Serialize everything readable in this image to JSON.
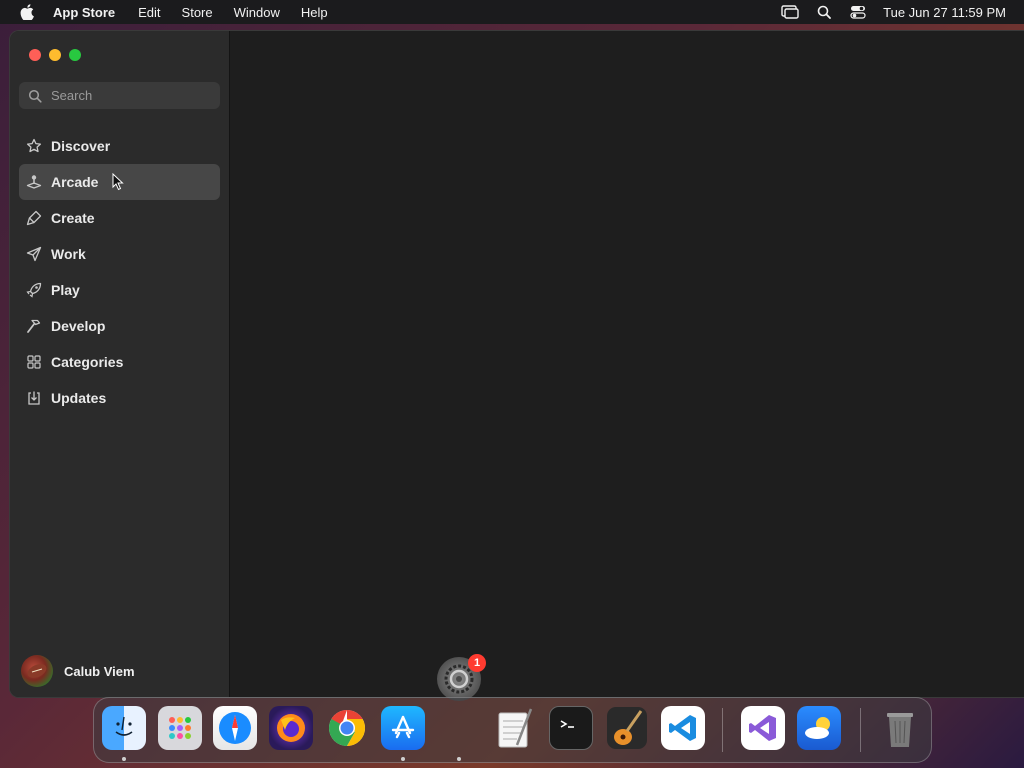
{
  "menubar": {
    "app_name": "App Store",
    "items": [
      "Edit",
      "Store",
      "Window",
      "Help"
    ],
    "clock": "Tue Jun 27  11:59 PM"
  },
  "sidebar": {
    "search_placeholder": "Search",
    "items": [
      {
        "label": "Discover",
        "icon": "star-icon"
      },
      {
        "label": "Arcade",
        "icon": "joystick-icon",
        "selected": true
      },
      {
        "label": "Create",
        "icon": "brush-icon"
      },
      {
        "label": "Work",
        "icon": "paper-plane-icon"
      },
      {
        "label": "Play",
        "icon": "rocket-icon"
      },
      {
        "label": "Develop",
        "icon": "hammer-icon"
      },
      {
        "label": "Categories",
        "icon": "grid-icon"
      },
      {
        "label": "Updates",
        "icon": "download-icon"
      }
    ],
    "user_name": "Calub Viem"
  },
  "dock": {
    "settings_badge": "1",
    "apps": [
      "Finder",
      "Launchpad",
      "Safari",
      "Firefox",
      "Chrome",
      "App Store",
      "TextEdit",
      "Terminal",
      "GarageBand",
      "Visual Studio Code",
      "Visual Studio",
      "Weather",
      "Trash"
    ]
  },
  "colors": {
    "close": "#fe5f57",
    "minimize": "#febc2e",
    "maximize": "#28c840",
    "badge": "#ff3b30",
    "sidebar_selected": "#474747"
  }
}
